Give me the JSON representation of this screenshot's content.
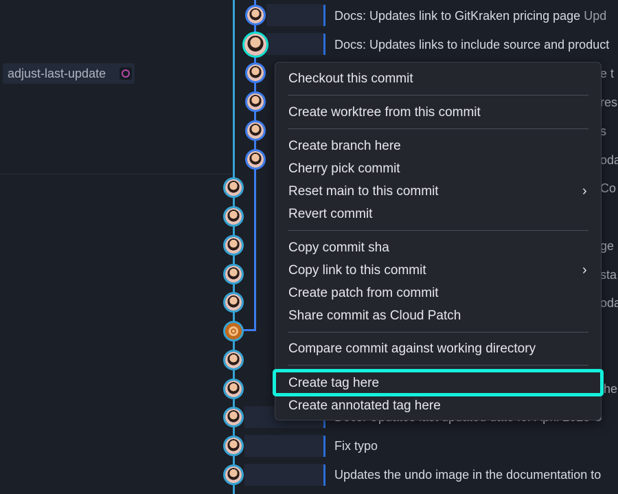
{
  "branch": {
    "label": "adjust-last-update",
    "icon": "worktree-ring-icon"
  },
  "commits": [
    {
      "message": "Docs: Updates link to GitKraken pricing page",
      "rest": "Upd"
    },
    {
      "message": "Docs: Updates links to include source and product",
      "rest": ""
    },
    {
      "message": "Docs: Updates last updated date for April 2025",
      "rest": "U"
    },
    {
      "message": "Fix typo",
      "rest": ""
    },
    {
      "message": "Updates the undo image in the documentation to",
      "rest": ""
    }
  ],
  "obscured_fragments": [
    "e t",
    "res",
    "s",
    "oda",
    "Co",
    "ge",
    "sta",
    "oda",
    "the"
  ],
  "context_menu": {
    "groups": [
      [
        "Checkout this commit"
      ],
      [
        "Create worktree from this commit"
      ],
      [
        "Create branch here",
        "Cherry pick commit",
        "Reset main to this commit",
        "Revert commit"
      ],
      [
        "Copy commit sha",
        "Copy link to this commit",
        "Create patch from commit",
        "Share commit as Cloud Patch"
      ],
      [
        "Compare commit against working directory"
      ],
      [
        "Create tag here",
        "Create annotated tag here"
      ]
    ],
    "submenu_icon": "chevron-right-icon",
    "highlighted_item": "Create tag here",
    "highlight_color": "#14f0dc"
  },
  "colors": {
    "background": "#1b1f27",
    "lane_blue": "#3d7df0",
    "lane_cyan": "#36a3d4",
    "selected_ring": "#10e0d2",
    "merge_node": "#c46a1b"
  }
}
